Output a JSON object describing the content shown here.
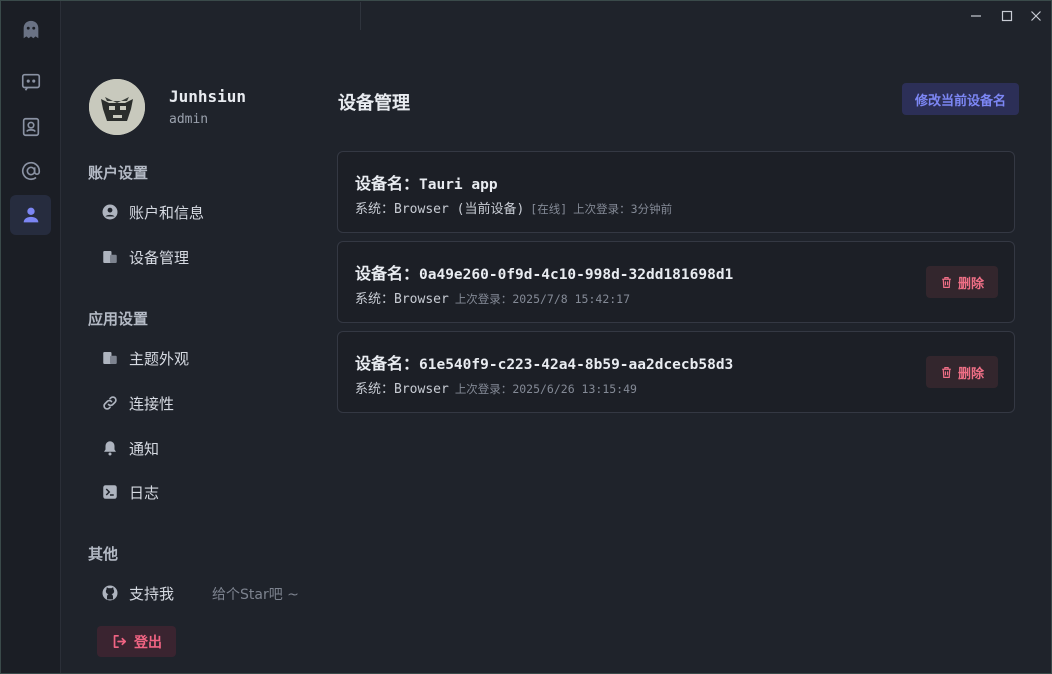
{
  "rail": {
    "items": [
      {
        "icon": "ghost-logo-icon"
      },
      {
        "icon": "chat-icon"
      },
      {
        "icon": "contacts-icon"
      },
      {
        "icon": "at-icon"
      },
      {
        "icon": "user-icon",
        "active": true
      }
    ]
  },
  "profile": {
    "username": "Junhsiun",
    "role": "admin"
  },
  "sections": {
    "account_title": "账户设置",
    "app_title": "应用设置",
    "other_title": "其他"
  },
  "nav": {
    "account_info": "账户和信息",
    "device_mgmt": "设备管理",
    "theme": "主题外观",
    "connectivity": "连接性",
    "notifications": "通知",
    "logs": "日志",
    "support": "支持我",
    "support_hint": "给个Star吧 ~"
  },
  "logout_label": "登出",
  "main": {
    "title": "设备管理",
    "rename_button": "修改当前设备名"
  },
  "devices": [
    {
      "name_label": "设备名：",
      "name": "Tauri app",
      "sys_label": "系统：",
      "system": "Browser (当前设备)",
      "status": "[在线]",
      "last_login_label": "上次登录：",
      "last_login": "3分钟前"
    },
    {
      "name_label": "设备名：",
      "name": "0a49e260-0f9d-4c10-998d-32dd181698d1",
      "sys_label": "系统：",
      "system": "Browser",
      "last_login_label": "上次登录：",
      "last_login": "2025/7/8 15:42:17",
      "delete_label": "删除"
    },
    {
      "name_label": "设备名：",
      "name": "61e540f9-c223-42a4-8b59-aa2dcecb58d3",
      "sys_label": "系统：",
      "system": "Browser",
      "last_login_label": "上次登录：",
      "last_login": "2025/6/26 13:15:49",
      "delete_label": "删除"
    }
  ],
  "colors": {
    "accent": "#7c86f4",
    "danger": "#ef6f86",
    "background": "#1f232b",
    "rail": "#1b1e25"
  }
}
